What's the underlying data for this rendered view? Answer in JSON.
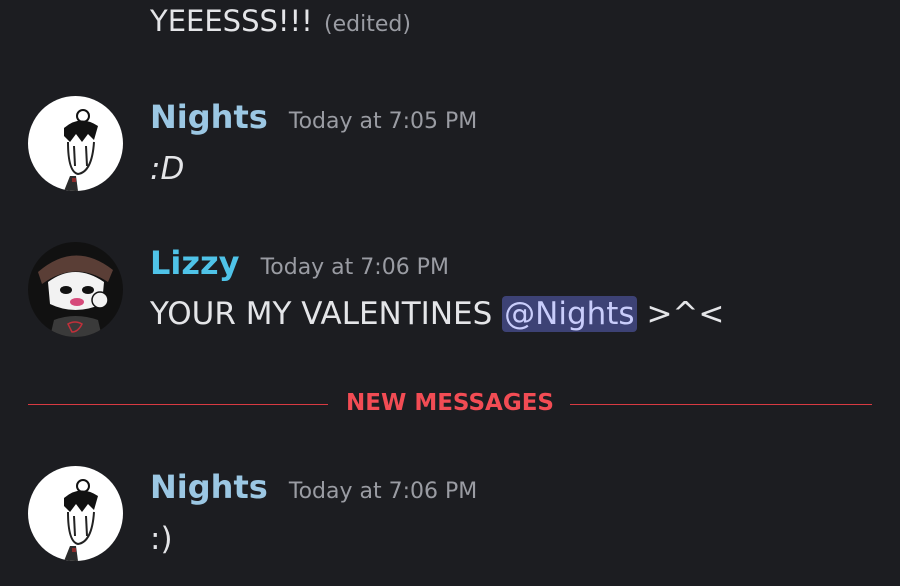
{
  "top_message": {
    "text": "YEEESSS!!!",
    "edited_tag": "(edited)"
  },
  "messages": [
    {
      "username": "Nights",
      "timestamp": "Today at 7:05 PM",
      "content": ":D",
      "avatar_icon": "nights-avatar-icon"
    },
    {
      "username": "Lizzy",
      "timestamp": "Today at 7:06 PM",
      "content_prefix": "YOUR MY VALENTINES",
      "mention": "@Nights",
      "content_suffix": ">^<",
      "avatar_icon": "lizzy-avatar-icon"
    },
    {
      "username": "Nights",
      "timestamp": "Today at 7:06 PM",
      "content": ":)",
      "avatar_icon": "nights-avatar-icon"
    }
  ],
  "divider": {
    "label": "NEW MESSAGES"
  },
  "colors": {
    "background": "#1c1d21",
    "nights_name": "#9bc7e3",
    "lizzy_name": "#4fc3e8",
    "timestamp": "#9a9ca3",
    "mention_bg": "#3d4275",
    "new_messages": "#f24c54"
  }
}
